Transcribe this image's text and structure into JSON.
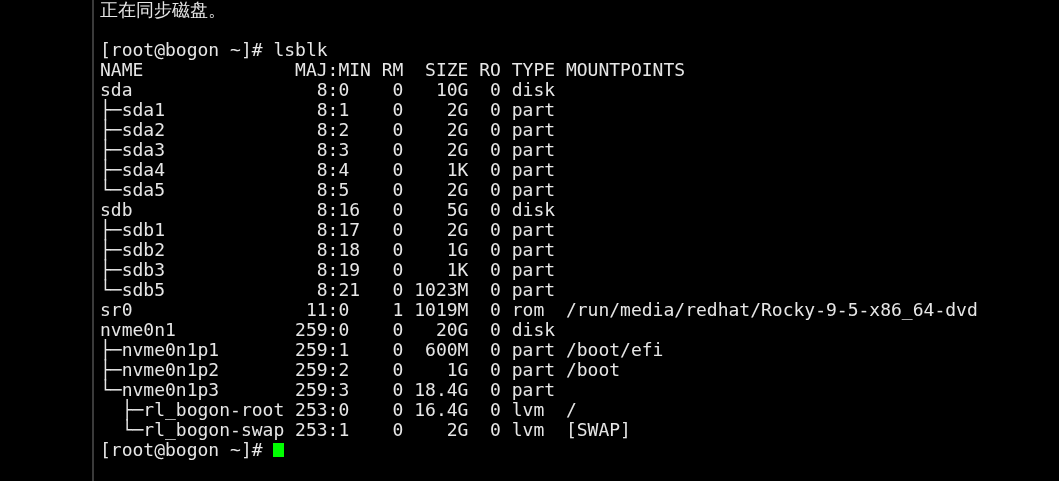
{
  "terminal": {
    "message": "正在同步磁盘。",
    "command_prompt": "[root@bogon ~]#",
    "command": "lsblk",
    "columns": [
      "NAME",
      "MAJ:MIN",
      "RM",
      "SIZE",
      "RO",
      "TYPE",
      "MOUNTPOINTS"
    ],
    "rows": [
      {
        "name": "sda",
        "maj_min": "8:0",
        "rm": "0",
        "size": "10G",
        "ro": "0",
        "type": "disk",
        "children": [
          {
            "name": "├─sda1",
            "maj_min": "8:1",
            "rm": "0",
            "size": "2G",
            "ro": "0",
            "type": "part"
          },
          {
            "name": "├─sda2",
            "maj_min": "8:2",
            "rm": "0",
            "size": "2G",
            "ro": "0",
            "type": "part"
          },
          {
            "name": "├─sda3",
            "maj_min": "8:3",
            "rm": "0",
            "size": "2G",
            "ro": "0",
            "type": "part"
          },
          {
            "name": "├─sda4",
            "maj_min": "8:4",
            "rm": "0",
            "size": "1K",
            "ro": "0",
            "type": "part"
          },
          {
            "name": "└─sda5",
            "maj_min": "8:5",
            "rm": "0",
            "size": "2G",
            "ro": "0",
            "type": "part"
          }
        ]
      },
      {
        "name": "sdb",
        "maj_min": "8:16",
        "rm": "0",
        "size": "5G",
        "ro": "0",
        "type": "disk",
        "children": [
          {
            "name": "├─sdb1",
            "maj_min": "8:17",
            "rm": "0",
            "size": "2G",
            "ro": "0",
            "type": "part"
          },
          {
            "name": "├─sdb2",
            "maj_min": "8:18",
            "rm": "0",
            "size": "1G",
            "ro": "0",
            "type": "part"
          },
          {
            "name": "├─sdb3",
            "maj_min": "8:19",
            "rm": "0",
            "size": "1K",
            "ro": "0",
            "type": "part"
          },
          {
            "name": "└─sdb5",
            "maj_min": "8:21",
            "rm": "0",
            "size": "1023M",
            "ro": "0",
            "type": "part"
          }
        ]
      },
      {
        "name": "sr0",
        "maj_min": "11:0",
        "rm": "1",
        "size": "1019M",
        "ro": "0",
        "type": "rom",
        "mountpoint": "/run/media/redhat/Rocky-9-5-x86_64-dvd"
      },
      {
        "name": "nvme0n1",
        "maj_min": "259:0",
        "rm": "0",
        "size": "20G",
        "ro": "0",
        "type": "disk",
        "children": [
          {
            "name": "├─nvme0n1p1",
            "maj_min": "259:1",
            "rm": "0",
            "size": "600M",
            "ro": "0",
            "type": "part",
            "mountpoint": "/boot/efi"
          },
          {
            "name": "├─nvme0n1p2",
            "maj_min": "259:2",
            "rm": "0",
            "size": "1G",
            "ro": "0",
            "type": "part",
            "mountpoint": "/boot"
          },
          {
            "name": "└─nvme0n1p3",
            "maj_min": "259:3",
            "rm": "0",
            "size": "18.4G",
            "ro": "0",
            "type": "part",
            "children": [
              {
                "name": "  ├─rl_bogon-root",
                "maj_min": "253:0",
                "rm": "0",
                "size": "16.4G",
                "ro": "0",
                "type": "lvm",
                "mountpoint": "/"
              },
              {
                "name": "  └─rl_bogon-swap",
                "maj_min": "253:1",
                "rm": "0",
                "size": "2G",
                "ro": "0",
                "type": "lvm",
                "mountpoint": "[SWAP]"
              }
            ]
          }
        ]
      }
    ],
    "final_prompt": "[root@bogon ~]#"
  }
}
